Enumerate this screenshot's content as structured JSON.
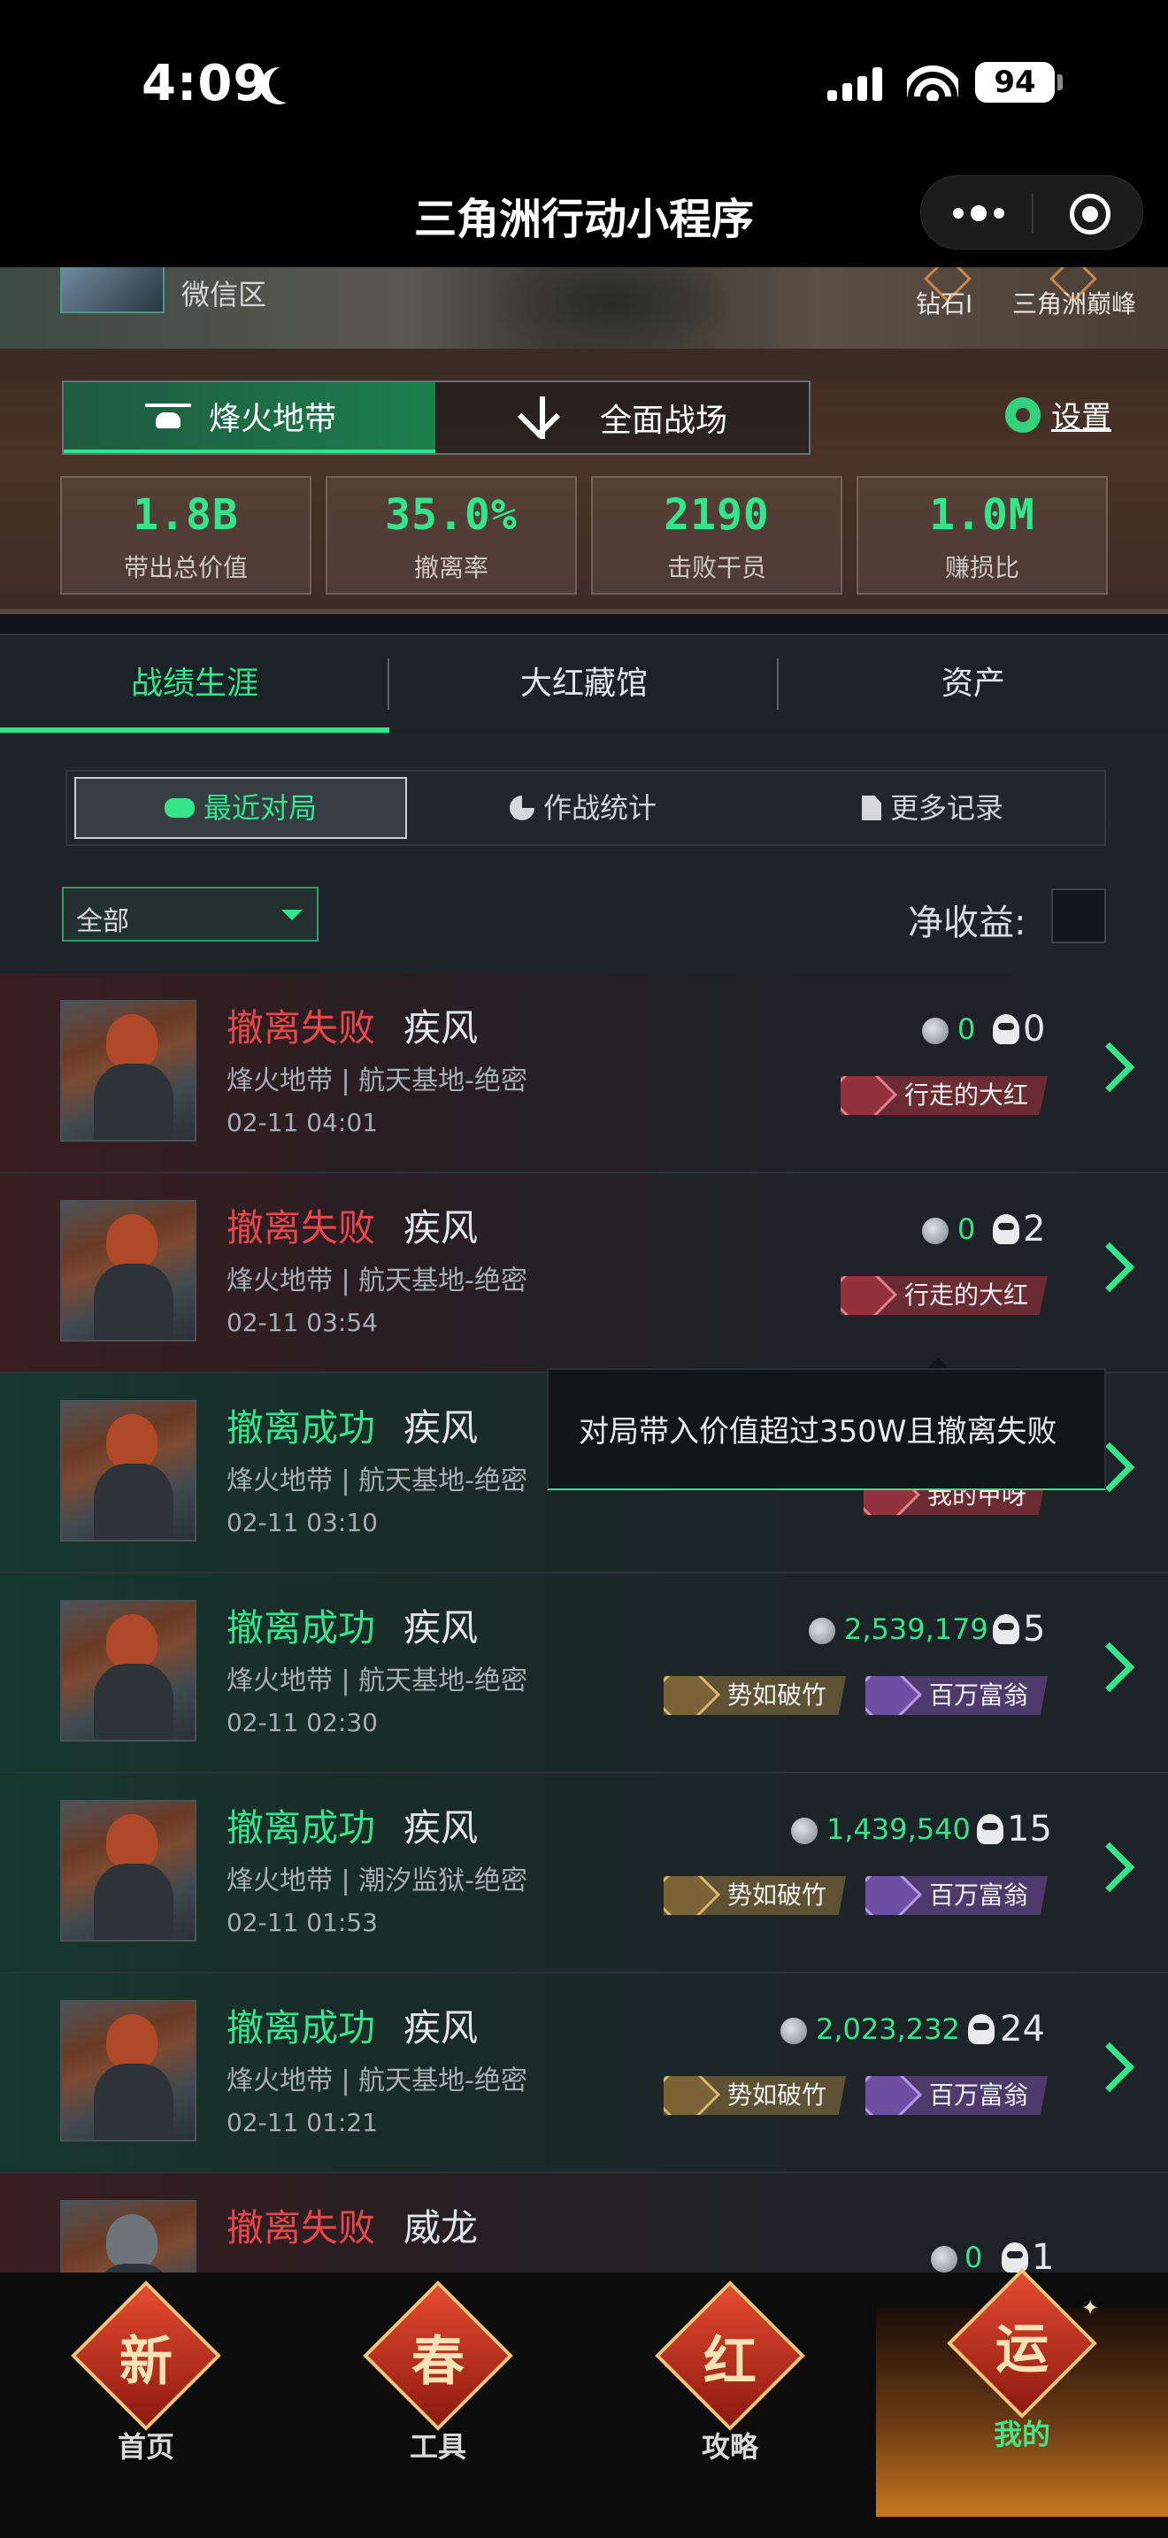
{
  "status_bar": {
    "time": "4:09",
    "battery": "94"
  },
  "title_bar": {
    "title": "三角洲行动小程序"
  },
  "profile": {
    "region": "微信区",
    "ranks": [
      "钻石I",
      "三角洲巅峰"
    ]
  },
  "mode_switch": {
    "active": "烽火地带",
    "inactive": "全面战场",
    "settings_label": "设置"
  },
  "stats": [
    {
      "value": "1.8B",
      "label": "带出总价值"
    },
    {
      "value": "35.0%",
      "label": "撤离率"
    },
    {
      "value": "2190",
      "label": "击败干员"
    },
    {
      "value": "1.0M",
      "label": "赚损比"
    }
  ],
  "main_tabs": [
    "战绩生涯",
    "大红藏馆",
    "资产"
  ],
  "sub_tabs": [
    "最近对局",
    "作战统计",
    "更多记录"
  ],
  "filter": {
    "selected": "全部",
    "net_label": "净收益:"
  },
  "matches": [
    {
      "result": "撤离失败",
      "operator": "疾风",
      "map": "烽火地带 | 航天基地-绝密",
      "time": "02-11 04:01",
      "value": "0",
      "kills": "0",
      "tags": [
        "行走的大红"
      ]
    },
    {
      "result": "撤离失败",
      "operator": "疾风",
      "map": "烽火地带 | 航天基地-绝密",
      "time": "02-11 03:54",
      "value": "0",
      "kills": "2",
      "tags": [
        "行走的大红"
      ]
    },
    {
      "result": "撤离成功",
      "operator": "疾风",
      "map": "烽火地带 | 航天基地-绝密",
      "time": "02-11 03:10",
      "value": "",
      "kills": "",
      "tags": [
        "我的甲呀"
      ]
    },
    {
      "result": "撤离成功",
      "operator": "疾风",
      "map": "烽火地带 | 航天基地-绝密",
      "time": "02-11 02:30",
      "value": "2,539,179",
      "kills": "5",
      "tags": [
        "势如破竹",
        "百万富翁"
      ]
    },
    {
      "result": "撤离成功",
      "operator": "疾风",
      "map": "烽火地带 | 潮汐监狱-绝密",
      "time": "02-11 01:53",
      "value": "1,439,540",
      "kills": "15",
      "tags": [
        "势如破竹",
        "百万富翁"
      ]
    },
    {
      "result": "撤离成功",
      "operator": "疾风",
      "map": "烽火地带 | 航天基地-绝密",
      "time": "02-11 01:21",
      "value": "2,023,232",
      "kills": "24",
      "tags": [
        "势如破竹",
        "百万富翁"
      ]
    },
    {
      "result": "撤离失败",
      "operator": "威龙",
      "map": "",
      "time": "",
      "value": "0",
      "kills": "1",
      "tags": []
    }
  ],
  "tooltip": {
    "text": "对局带入价值超过350W且撤离失败"
  },
  "bottom_nav": [
    {
      "emblem": "新",
      "label": "首页"
    },
    {
      "emblem": "春",
      "label": "工具"
    },
    {
      "emblem": "红",
      "label": "攻略"
    },
    {
      "emblem": "运",
      "label": "我的"
    }
  ],
  "colors": {
    "accent": "#34e58c",
    "fail": "#e7474b"
  }
}
